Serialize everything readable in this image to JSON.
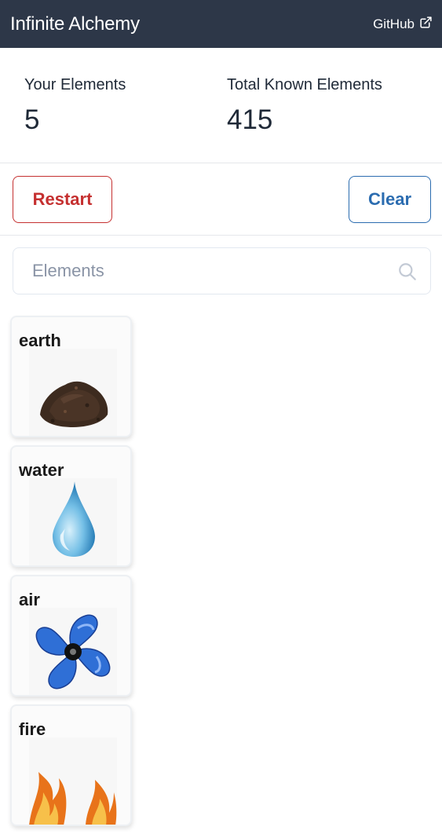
{
  "header": {
    "title": "Infinite Alchemy",
    "github_label": "GitHub",
    "external_link_icon": "external-link-icon"
  },
  "stats": {
    "your_elements_label": "Your Elements",
    "your_elements_value": "5",
    "total_known_label": "Total Known Elements",
    "total_known_value": "415"
  },
  "actions": {
    "restart_label": "Restart",
    "clear_label": "Clear"
  },
  "search": {
    "placeholder": "Elements",
    "value": "",
    "icon": "search-icon"
  },
  "elements": [
    {
      "label": "earth",
      "icon": "earth-pile-image"
    },
    {
      "label": "water",
      "icon": "water-drop-image"
    },
    {
      "label": "air",
      "icon": "fan-image"
    },
    {
      "label": "fire",
      "icon": "flame-image"
    }
  ],
  "colors": {
    "navbar": "#2d3748",
    "restart": "#c53030",
    "clear": "#2b6cb0"
  }
}
